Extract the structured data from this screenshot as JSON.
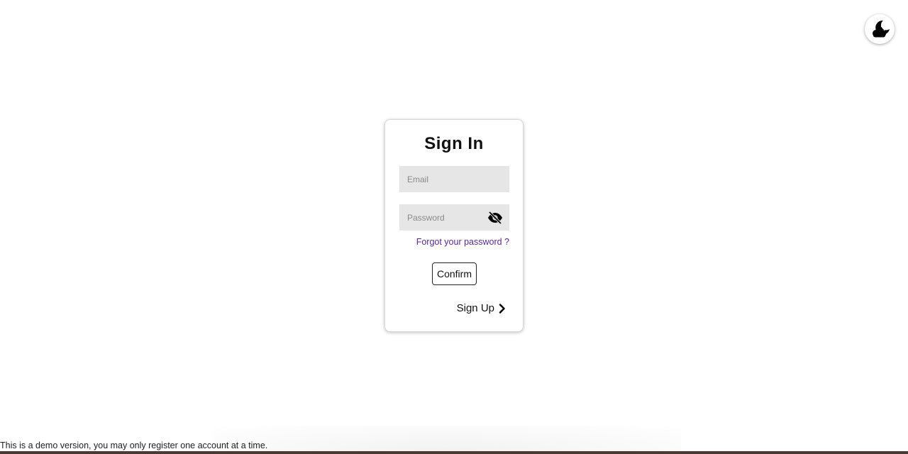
{
  "theme_toggle": {
    "icon": "moon-cloud-icon"
  },
  "signin": {
    "title": "Sign In",
    "email_placeholder": "Email",
    "email_value": "",
    "password_placeholder": "Password",
    "password_value": "",
    "password_visibility_icon": "eye-off-icon",
    "forgot_label": "Forgot your password ?",
    "confirm_label": "Confirm",
    "signup_label": "Sign Up",
    "signup_icon": "chevron-right-icon"
  },
  "footer": {
    "note": "This is a demo version, you may only register one account at a time."
  },
  "colors": {
    "link": "#5a2a8c",
    "field_background": "#e6e6e6",
    "footer_bar": "#4a3a36"
  }
}
